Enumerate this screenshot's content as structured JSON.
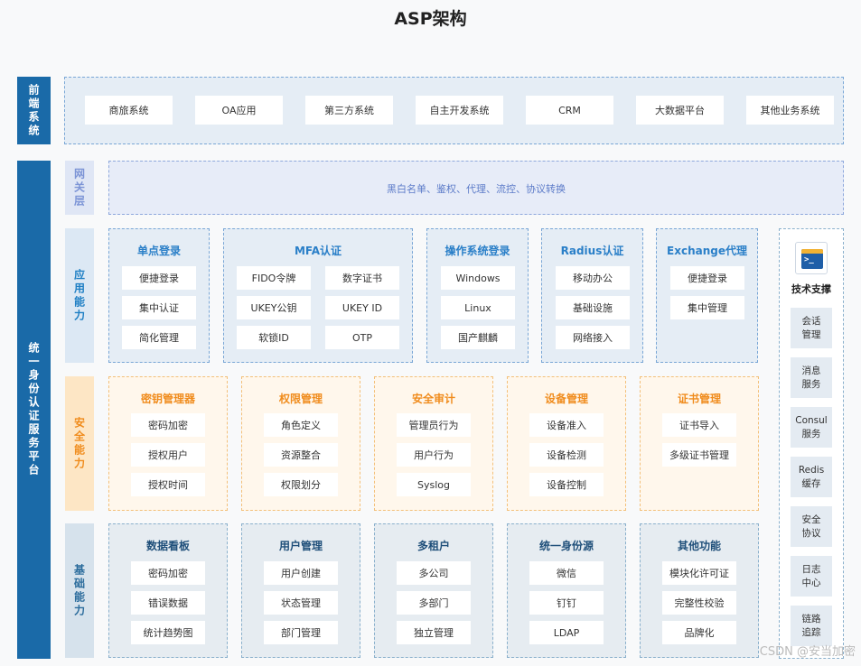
{
  "title": "ASP架构",
  "frontend": {
    "label": "前端系统",
    "systems": [
      "商旅系统",
      "OA应用",
      "第三方系统",
      "自主开发系统",
      "CRM",
      "大数据平台",
      "其他业务系统"
    ]
  },
  "platform_label": "统一身份认证服务平台",
  "gateway": {
    "label": "网关层",
    "text": "黑白名单、鉴权、代理、流控、协议转换"
  },
  "app": {
    "label": "应用能力",
    "groups": [
      {
        "title": "单点登录",
        "items": [
          "便捷登录",
          "集中认证",
          "简化管理"
        ]
      },
      {
        "title": "MFA认证",
        "items": [
          "FIDO令牌",
          "数字证书",
          "UKEY公钥",
          "UKEY ID",
          "软锁ID",
          "OTP"
        ]
      },
      {
        "title": "操作系统登录",
        "items": [
          "Windows",
          "Linux",
          "国产麒麟"
        ]
      },
      {
        "title": "Radius认证",
        "items": [
          "移动办公",
          "基础设施",
          "网络接入"
        ]
      },
      {
        "title": "Exchange代理",
        "items": [
          "便捷登录",
          "集中管理"
        ]
      }
    ]
  },
  "security": {
    "label": "安全能力",
    "groups": [
      {
        "title": "密钥管理器",
        "items": [
          "密码加密",
          "授权用户",
          "授权时间"
        ]
      },
      {
        "title": "权限管理",
        "items": [
          "角色定义",
          "资源整合",
          "权限划分"
        ]
      },
      {
        "title": "安全审计",
        "items": [
          "管理员行为",
          "用户行为",
          "Syslog"
        ]
      },
      {
        "title": "设备管理",
        "items": [
          "设备准入",
          "设备检测",
          "设备控制"
        ]
      },
      {
        "title": "证书管理",
        "items": [
          "证书导入",
          "多级证书管理"
        ]
      }
    ]
  },
  "base": {
    "label": "基础能力",
    "groups": [
      {
        "title": "数据看板",
        "items": [
          "密码加密",
          "错误数据",
          "统计趋势图"
        ]
      },
      {
        "title": "用户管理",
        "items": [
          "用户创建",
          "状态管理",
          "部门管理"
        ]
      },
      {
        "title": "多租户",
        "items": [
          "多公司",
          "多部门",
          "独立管理"
        ]
      },
      {
        "title": "统一身份源",
        "items": [
          "微信",
          "钉钉",
          "LDAP"
        ]
      },
      {
        "title": "其他功能",
        "items": [
          "模块化许可证",
          "完整性校验",
          "品牌化"
        ]
      }
    ]
  },
  "support": {
    "title": "技术支撑",
    "icon": "terminal-icon",
    "items": [
      [
        "会话",
        "管理"
      ],
      [
        "消息",
        "服务"
      ],
      [
        "Consul",
        "服务"
      ],
      [
        "Redis",
        "缓存"
      ],
      [
        "安全",
        "协议"
      ],
      [
        "日志",
        "中心"
      ],
      [
        "链路",
        "追踪"
      ]
    ]
  },
  "watermark": "CSDN @安当加密",
  "colors": {
    "primary": "#1a6aa8",
    "orange": "#f08c1d",
    "blue": "#2a7fc8",
    "gateway": "#5d7cc9"
  }
}
